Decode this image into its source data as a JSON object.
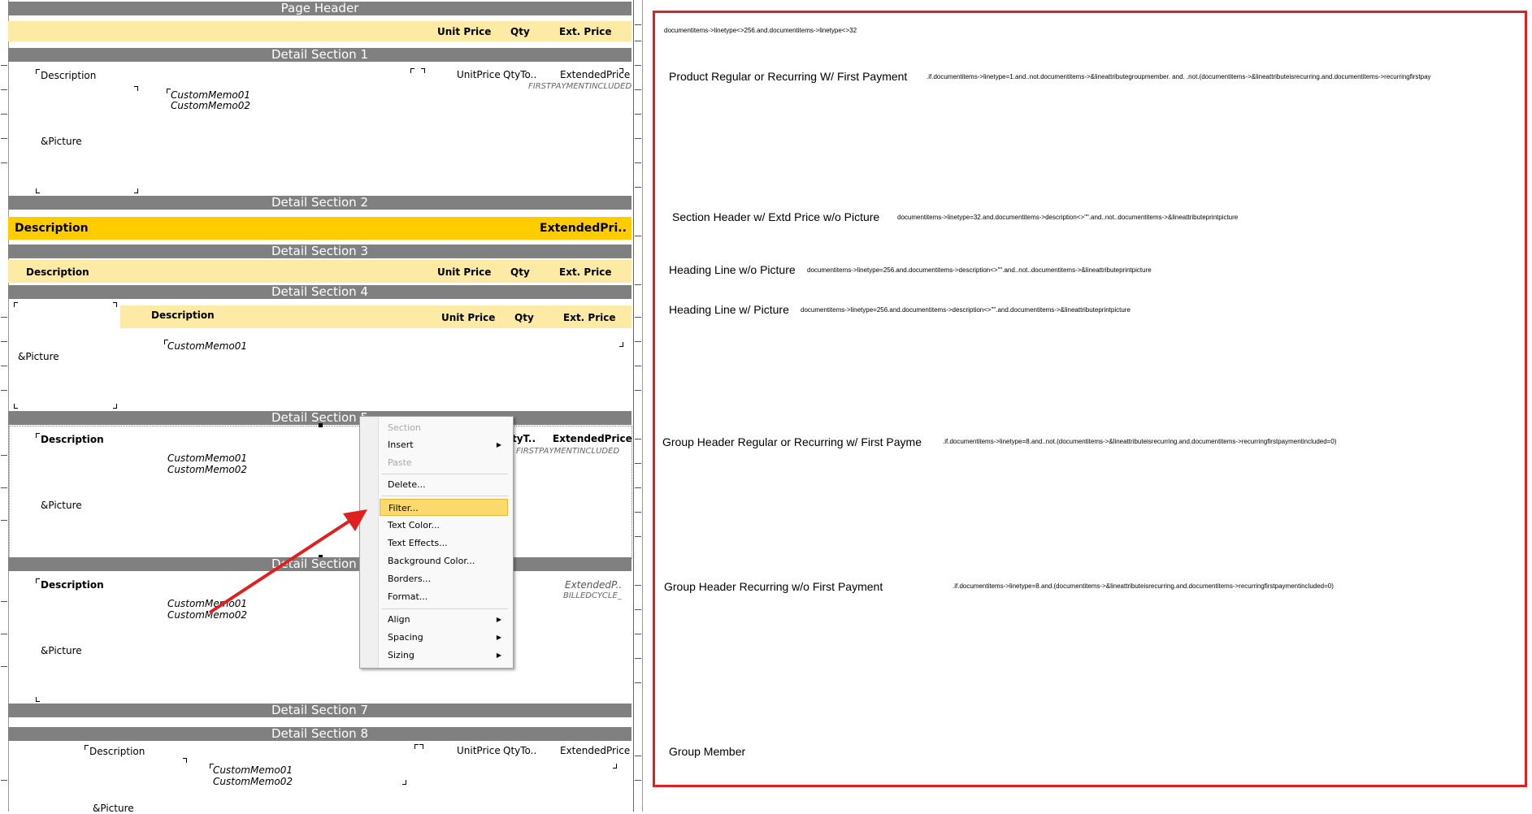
{
  "bands": {
    "page_header": "Page Header",
    "detail1": "Detail Section 1",
    "detail2": "Detail Section 2",
    "detail3": "Detail Section 3",
    "detail4": "Detail Section 4",
    "detail5": "Detail Section 5",
    "detail6": "Detail Section 6",
    "detail7": "Detail Section 7",
    "detail8": "Detail Section 8"
  },
  "page_header": {
    "unit_price": "Unit Price",
    "qty": "Qty",
    "ext_price": "Ext. Price"
  },
  "detail1": {
    "description": "Description",
    "custom_memo01": "CustomMemo01",
    "custom_memo02": "CustomMemo02",
    "picture": "&Picture",
    "unit_price": "UnitPrice",
    "qty": "QtyTo..",
    "extended_price": "ExtendedPrice",
    "first_payment": "FIRSTPAYMENTINCLUDED"
  },
  "detail2": {
    "description": "Description",
    "extended_price": "ExtendedPri.."
  },
  "detail3": {
    "description": "Description",
    "unit_price": "Unit Price",
    "qty": "Qty",
    "ext_price": "Ext. Price"
  },
  "detail4": {
    "description": "Description",
    "unit_price": "Unit Price",
    "qty": "Qty",
    "ext_price": "Ext. Price",
    "custom_memo01": "CustomMemo01",
    "picture": "&Picture"
  },
  "detail5": {
    "description": "Description",
    "custom_memo01": "CustomMemo01",
    "custom_memo02": "CustomMemo02",
    "picture": "&Picture",
    "qty": "tyT..",
    "extended_price": "ExtendedPrice",
    "first_payment": "FIRSTPAYMENTINCLUDED"
  },
  "detail6": {
    "description": "Description",
    "custom_memo01": "CustomMemo01",
    "custom_memo02": "CustomMemo02",
    "picture": "&Picture",
    "extended_price": "ExtendedP..",
    "billed_cycle": "BILLEDCYCLE_"
  },
  "detail8": {
    "description": "Description",
    "custom_memo01": "CustomMemo01",
    "custom_memo02": "CustomMemo02",
    "picture": "&Picture",
    "unit_price": "UnitPrice",
    "qty": "QtyTo..",
    "extended_price": "ExtendedPrice"
  },
  "context_menu": {
    "section": "Section",
    "insert": "Insert",
    "paste": "Paste",
    "delete": "Delete...",
    "filter": "Filter...",
    "text_color": "Text Color...",
    "text_effects": "Text Effects...",
    "background_color": "Background Color...",
    "borders": "Borders...",
    "format": "Format...",
    "align": "Align",
    "spacing": "Spacing",
    "sizing": "Sizing"
  },
  "conditions": {
    "page_header": "documentitems->linetype<>256.and.documentitems->linetype<>32",
    "detail1_label": "Product Regular or Recurring W/ First Payment",
    "detail1_expr": ".if.documentitems->linetype=1.and..not.documentitems->&lineattributegroupmember. and. .not.(documentitems->&lineattributeisrecurring.and.documentitems->recurringfirstpay",
    "detail2_label": "Section Header w/ Extd Price w/o Picture",
    "detail2_expr": "documentitems->linetype=32.and.documentitems->description<>\"\".and..not..documentitems->&lineattributeprintpicture",
    "detail3_label": "Heading Line w/o Picture",
    "detail3_expr": "documentitems->linetype=256.and.documentitems->description<>\"\".and..not..documentitems->&lineattributeprintpicture",
    "detail4_label": "Heading Line w/ Picture",
    "detail4_expr": "documentitems->linetype=256.and.documentitems->description<>\"\".and.documentitems->&lineattributeprintpicture",
    "detail5_label": "Group Header  Regular or Recurring w/ First Payme",
    "detail5_expr": ".if.documentitems->linetype=8.and..not.(documentitems->&lineattributeisrecurring.and.documentitems->recurringfirstpaymentincluded=0)",
    "detail6_label": "Group Header Recurring w/o First Payment",
    "detail6_expr": ".if.documentitems->linetype=8.and.(documentitems->&lineattributeisrecurring.and.documentitems->recurringfirstpaymentincluded=0)",
    "detail8_label": "Group Member"
  },
  "colors": {
    "band": "#808080",
    "header_yellow": "#fdeaa5",
    "section_gold": "#ffcc00",
    "highlight": "#fbd96b",
    "annotation_red": "#e02020"
  }
}
